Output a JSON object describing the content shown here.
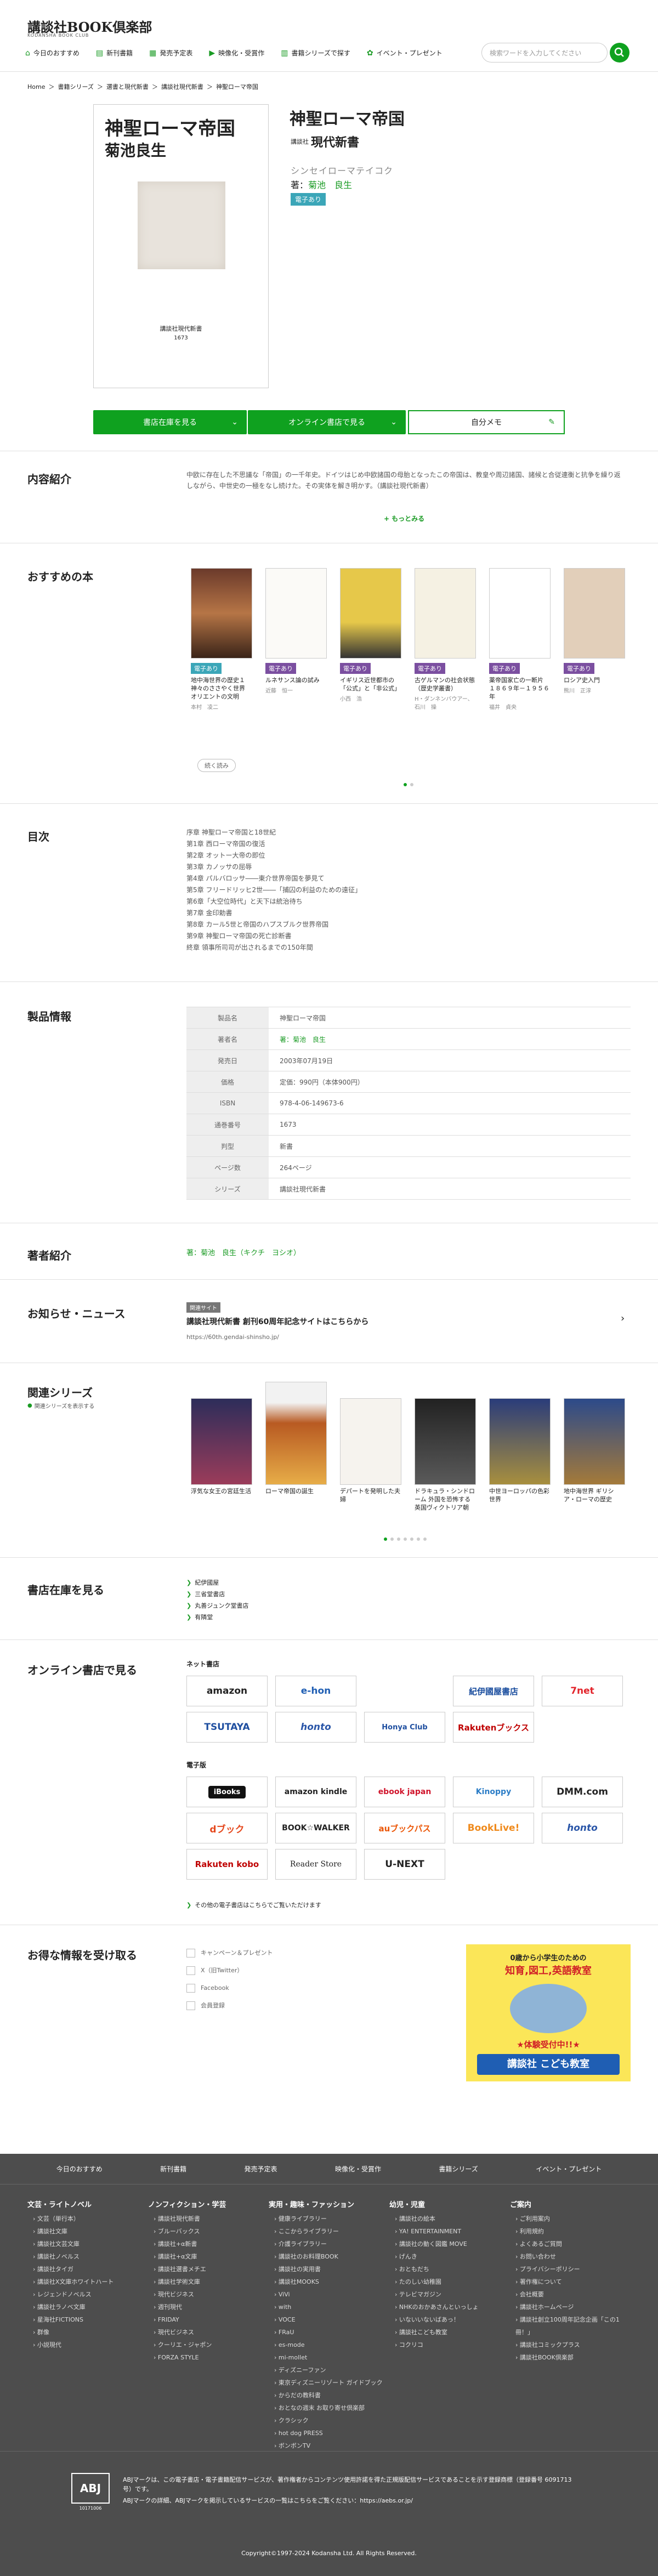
{
  "site": {
    "logo": "講談社BOOK倶楽部",
    "logo_sub": "KODANSHA BOOK CLUB",
    "search_placeholder": "検索ワードを入力してください"
  },
  "nav": [
    {
      "label": "今日のおすすめ",
      "icon": "home-icon"
    },
    {
      "label": "新刊書籍",
      "icon": "book-icon"
    },
    {
      "label": "発売予定表",
      "icon": "calendar-icon"
    },
    {
      "label": "映像化・受賞作",
      "icon": "video-icon"
    },
    {
      "label": "書籍シリーズで探す",
      "icon": "books-icon"
    },
    {
      "label": "イベント・プレゼント",
      "icon": "gift-icon"
    }
  ],
  "breadcrumb": [
    "Home",
    "書籍シリーズ",
    "選書と現代新書",
    "講談社現代新書",
    "神聖ローマ帝国"
  ],
  "book": {
    "title": "神聖ローマ帝国",
    "cover_title": "神聖ローマ帝国",
    "cover_author": "菊池良生",
    "cover_series": "講談社現代新書",
    "cover_number": "1673",
    "publisher_prefix": "講談社",
    "series_name": "現代新書",
    "reading": "シンセイローマテイコク",
    "author_prefix": "著：",
    "author": "菊池　良生",
    "badge": "電子あり"
  },
  "actions": {
    "stock": "書店在庫を見る",
    "online": "オンライン書店で見る",
    "memo": "自分メモ"
  },
  "intro": {
    "heading": "内容紹介",
    "text": "中欧に存在した不思議な「帝国」の一千年史。ドイツはじめ中欧諸国の母胎となったこの帝国は、教皇や周辺諸国、諸候と合従連衡と抗争を繰り返しながら、中世史の一極をなし続けた。その実体を解き明かす。（講談社現代新書）",
    "more": "もっとみる"
  },
  "recommend": {
    "heading": "おすすめの本",
    "items": [
      {
        "tag": "電子あり",
        "title": "地中海世界の歴史１ 神々のささやく世界 オリエントの文明",
        "author": "本村　凌二"
      },
      {
        "tag": "電子あり",
        "title": "ルネサンス論の試み",
        "author": "近藤　恒一"
      },
      {
        "tag": "電子あり",
        "title": "イギリス近世都市の「公式」と「非公式」",
        "author": "小西　浩"
      },
      {
        "tag": "電子あり",
        "title": "古ゲルマンの社会状態（歴史学叢書）",
        "author": "H・ダンネンバウアー、石川　操"
      },
      {
        "tag": "電子あり",
        "title": "薬帝国家亡の一断片 １８６９年－１９５６年",
        "author": "福井　貞央"
      },
      {
        "tag": "電子あり",
        "title": "ロシア史入門",
        "author": "熊川　正淳"
      }
    ],
    "show_more": "続く読み"
  },
  "toc": {
    "heading": "目次",
    "items": [
      "序章 神聖ローマ帝国と18世紀",
      "第1章 西ローマ帝国の復活",
      "第2章 オットー大帝の即位",
      "第3章 カノッサの屈辱",
      "第4章 パルバロッサ――東介世界帝国を夢見て",
      "第5章 フリードリッヒ2世――「捕囚の利益のための遠征」",
      "第6章「大空位時代」と天下は統治待ち",
      "第7章 金印勅書",
      "第8章 カール5世と帝国のハプスブルク世界帝国",
      "第9章 神聖ローマ帝国の死亡診断書",
      "終章 領事所司司が出されるまでの150年間"
    ]
  },
  "info": {
    "heading": "製品情報",
    "rows": [
      {
        "k": "製品名",
        "v": "神聖ローマ帝国"
      },
      {
        "k": "著者名",
        "v": "著：菊池　良生"
      },
      {
        "k": "発売日",
        "v": "2003年07月19日"
      },
      {
        "k": "価格",
        "v": "定価：990円（本体900円）"
      },
      {
        "k": "ISBN",
        "v": "978-4-06-149673-6"
      },
      {
        "k": "通巻番号",
        "v": "1673"
      },
      {
        "k": "判型",
        "v": "新書"
      },
      {
        "k": "ページ数",
        "v": "264ページ"
      },
      {
        "k": "シリーズ",
        "v": "講談社現代新書"
      }
    ]
  },
  "author_sec": {
    "heading": "著者紹介",
    "text": "著：菊池　良生（キクチ　ヨシオ）"
  },
  "news": {
    "heading": "お知らせ・ニュース",
    "badge": "関連サイト",
    "title": "講談社現代新書 創刊60周年記念サイトはこちらから",
    "url": "https://60th.gendai-shinsho.jp/"
  },
  "related": {
    "heading": "関連シリーズ",
    "link": "関連シリーズを表示する",
    "items": [
      {
        "title": "浮気な女王の宮廷生活"
      },
      {
        "title": "ローマ帝国の誕生"
      },
      {
        "title": "デパートを発明した夫婦"
      },
      {
        "title": "ドラキュラ・シンドローム 外国を恐怖する英国ヴィクトリア朝"
      },
      {
        "title": "中世ヨーロッパの色彩世界"
      },
      {
        "title": "地中海世界 ギリシア・ローマの歴史"
      }
    ]
  },
  "stores": {
    "heading": "書店在庫を見る",
    "items": [
      "紀伊國屋",
      "三省堂書店",
      "丸善ジュンク堂書店",
      "有隣堂"
    ]
  },
  "online": {
    "heading": "オンライン書店で見る",
    "net": "ネット書店",
    "net_logos": [
      "amazon",
      "e-hon",
      "紀伊國屋書店",
      "7net",
      "TSUTAYA",
      "honto",
      "Honya Club",
      "Rakutenブックス"
    ],
    "ebook": "電子版",
    "ebook_logos": [
      "iBooks",
      "amazon kindle",
      "ebook japan",
      "Kinoppy",
      "DMM.com",
      "dブック",
      "BOOK☆WALKER",
      "auブックパス",
      "BookLive!",
      "honto",
      "Rakuten kobo",
      "Reader Store",
      "U-NEXT"
    ],
    "other": "その他の電子書店はこちらでご覧いただけます"
  },
  "benefits": {
    "heading": "お得な情報を受け取る",
    "items": [
      "キャンペーン＆プレゼント",
      "X（旧Twitter）",
      "Facebook",
      "会員登録"
    ],
    "ad_line1": "0歳から小学生のための",
    "ad_line2": "知育,図工,英語教室",
    "ad_line3": "★体験受付中!!★",
    "ad_line4": "講談社 こども教室"
  },
  "footer": {
    "nav": [
      "今日のおすすめ",
      "新刊書籍",
      "発売予定表",
      "映像化・受賞作",
      "書籍シリーズ",
      "イベント・プレゼント"
    ],
    "cols": [
      {
        "h": "文芸・ライトノベル",
        "links": [
          "文芸（単行本）",
          "講談社文庫",
          "講談社文芸文庫",
          "講談社ノベルス",
          "講談社タイガ",
          "講談社X文庫ホワイトハート",
          "レジェンドノベルス",
          "講談社ラノベ文庫",
          "星海社FICTIONS",
          "群像",
          "小説現代"
        ]
      },
      {
        "h": "ノンフィクション・学芸",
        "links": [
          "講談社現代新書",
          "ブルーバックス",
          "講談社+α新書",
          "講談社+α文庫",
          "講談社選書メチエ",
          "講談社学術文庫",
          "現代ビジネス",
          "週刊現代",
          "FRIDAY",
          "現代ビジネス",
          "クーリエ・ジャポン",
          "FORZA STYLE"
        ]
      },
      {
        "h": "実用・趣味・ファッション",
        "links": [
          "健康ライブラリー",
          "ここからライブラリー",
          "介護ライブラリー",
          "講談社のお料理BOOK",
          "講談社の実用書",
          "講談社MOOKS",
          "ViVi",
          "with",
          "VOCE",
          "FRaU",
          "es-mode",
          "mi-mollet",
          "ディズニーファン",
          "東京ディズニーリゾート ガイドブック",
          "からだの教科書",
          "おとなの週末 お取り寄せ倶楽部",
          "クラシック",
          "hot dog PRESS",
          "ボンボンTV"
        ]
      },
      {
        "h": "幼児・児童",
        "links": [
          "講談社の絵本",
          "YA! ENTERTAINMENT",
          "講談社の動く図鑑 MOVE",
          "げんき",
          "おともだち",
          "たのしい幼稚園",
          "テレビマガジン",
          "NHKのおかあさんといっしょ",
          "いないいないばあっ！",
          "講談社こども教室",
          "コクリコ"
        ]
      },
      {
        "h": "ご案内",
        "links": [
          "ご利用案内",
          "利用規約",
          "よくあるご質問",
          "お問い合わせ",
          "プライバシーポリシー",
          "著作権について",
          "会社概要",
          "講談社ホームページ",
          "講談社創立100周年記念企画「この1冊！」",
          "講談社コミックプラス",
          "講談社BOOK倶楽部"
        ]
      }
    ],
    "abj_text": "ABJマークは、この電子書店・電子書籍配信サービスが、著作権者からコンテンツ使用許諾を得た正規版配信サービスであることを示す登録商標（登録番号 6091713号）です。",
    "abj_text2": "ABJマークの詳細、ABJマークを掲示しているサービスの一覧はこちらをご覧ください：https://aebs.or.jp/",
    "abj_num": "10171006",
    "copyright": "Copyright©1997-2024 Kodansha Ltd. All Rights Reserved."
  },
  "colors": {
    "accent": "#0fa11f",
    "link": "#1a9b24",
    "footer_bg": "#4d4d4d",
    "tag_purple": "#7b4fa0",
    "badge_teal": "#3ba6b8"
  }
}
